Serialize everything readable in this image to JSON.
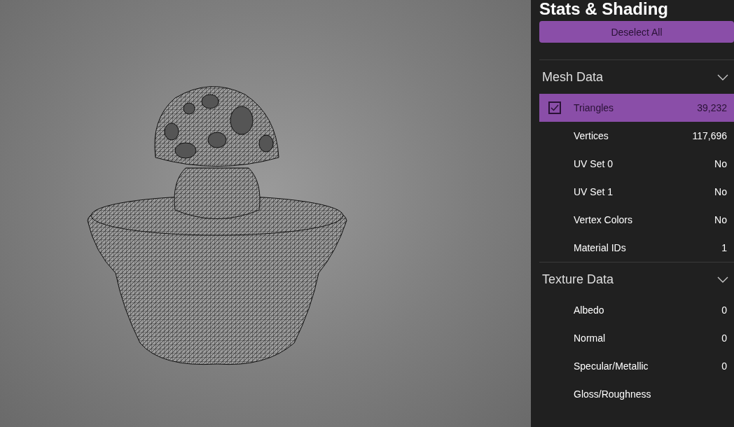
{
  "panel": {
    "title": "Stats & Shading",
    "deselect_button": "Deselect All",
    "sections": [
      {
        "title": "Mesh Data",
        "expanded": true,
        "rows": [
          {
            "label": "Triangles",
            "value": "39,232",
            "selected": true
          },
          {
            "label": "Vertices",
            "value": "117,696",
            "selected": false
          },
          {
            "label": "UV Set 0",
            "value": "No",
            "selected": false
          },
          {
            "label": "UV Set 1",
            "value": "No",
            "selected": false
          },
          {
            "label": "Vertex Colors",
            "value": "No",
            "selected": false
          },
          {
            "label": "Material IDs",
            "value": "1",
            "selected": false
          }
        ]
      },
      {
        "title": "Texture Data",
        "expanded": true,
        "rows": [
          {
            "label": "Albedo",
            "value": "0",
            "selected": false
          },
          {
            "label": "Normal",
            "value": "0",
            "selected": false
          },
          {
            "label": "Specular/Metallic",
            "value": "0",
            "selected": false
          },
          {
            "label": "Gloss/Roughness",
            "selected": false
          }
        ]
      }
    ]
  }
}
